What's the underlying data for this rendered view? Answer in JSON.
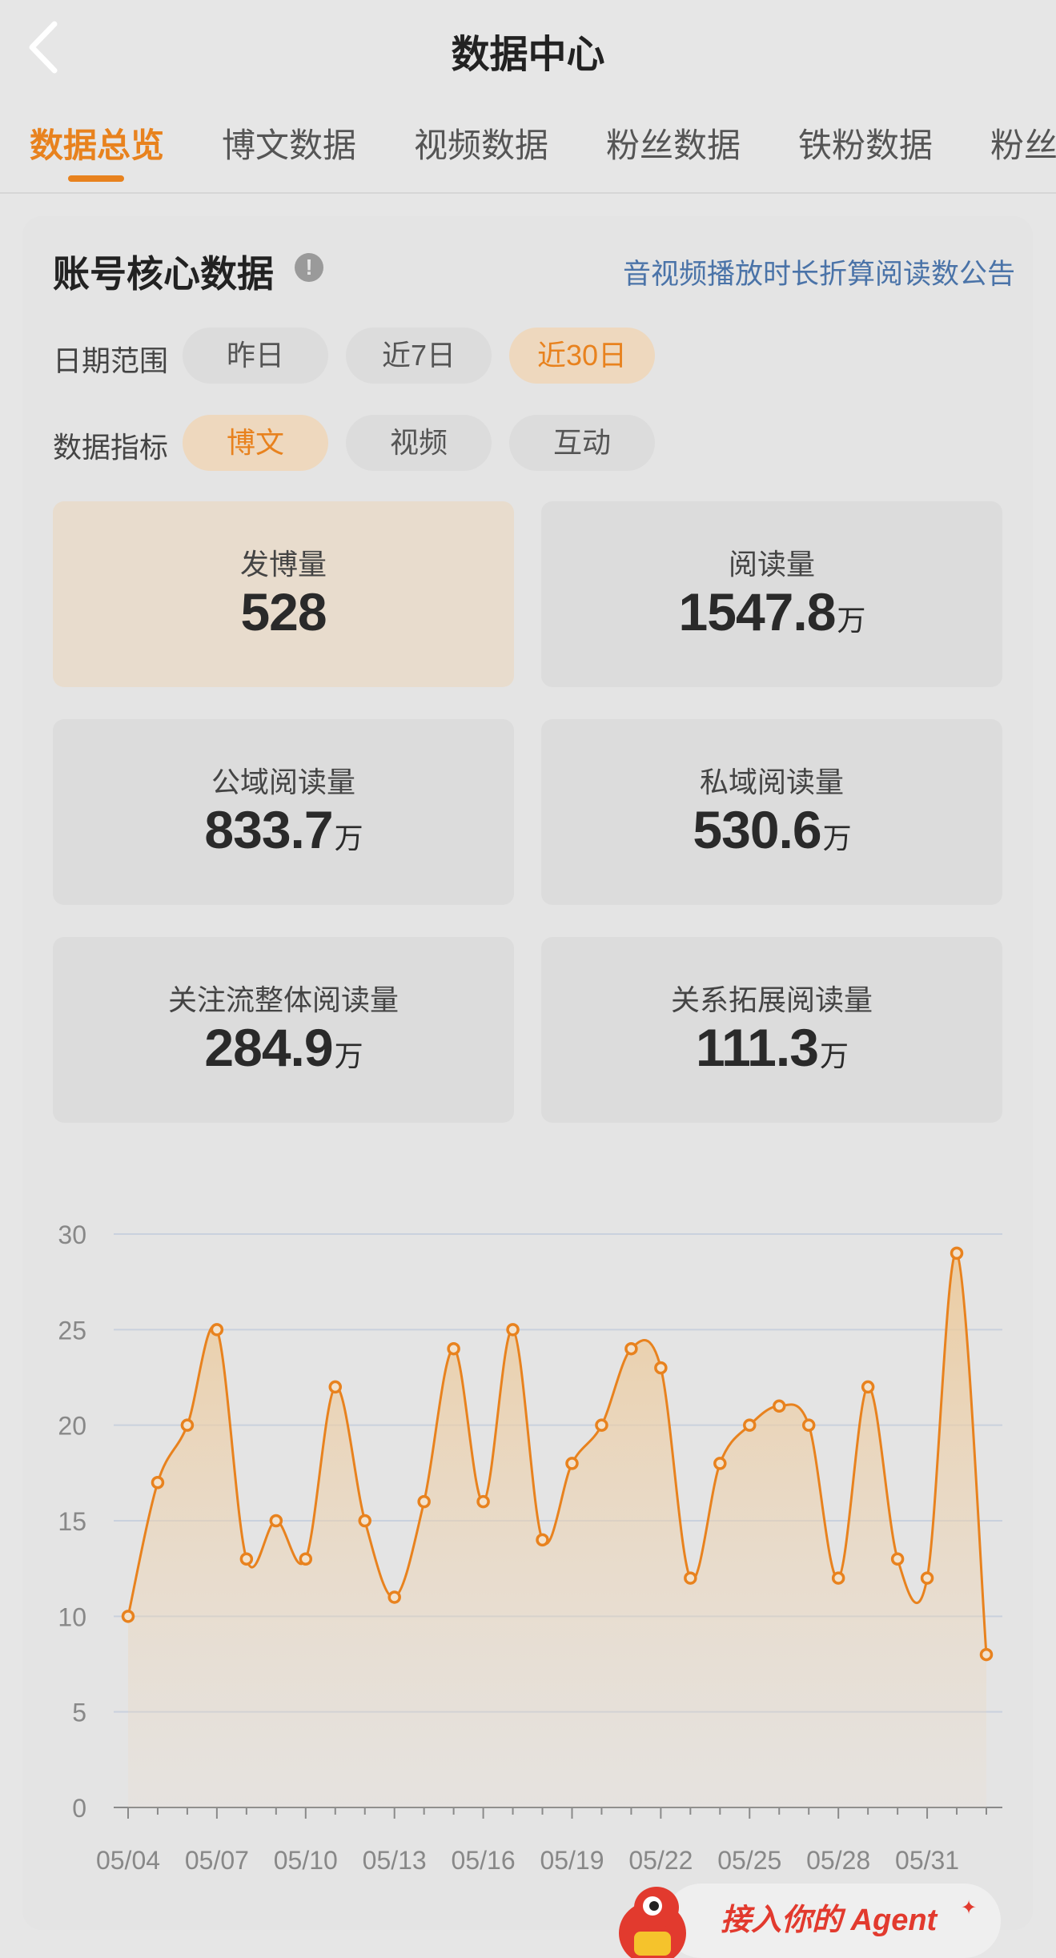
{
  "header": {
    "title": "数据中心"
  },
  "tabs": [
    {
      "label": "数据总览",
      "active": true
    },
    {
      "label": "博文数据"
    },
    {
      "label": "视频数据"
    },
    {
      "label": "粉丝数据"
    },
    {
      "label": "铁粉数据"
    },
    {
      "label": "粉丝"
    }
  ],
  "core": {
    "title": "账号核心数据",
    "info_icon": "!",
    "notice_link": "音视频播放时长折算阅读数公告",
    "date_range": {
      "label": "日期范围",
      "options": [
        "昨日",
        "近7日",
        "近30日"
      ],
      "selected": "近30日"
    },
    "metric": {
      "label": "数据指标",
      "options": [
        "博文",
        "视频",
        "互动"
      ],
      "selected": "博文"
    }
  },
  "stats": [
    {
      "label": "发博量",
      "value": "528",
      "unit": "",
      "active": true
    },
    {
      "label": "阅读量",
      "value": "1547.8",
      "unit": "万"
    },
    {
      "label": "公域阅读量",
      "value": "833.7",
      "unit": "万"
    },
    {
      "label": "私域阅读量",
      "value": "530.6",
      "unit": "万"
    },
    {
      "label": "关注流整体阅读量",
      "value": "284.9",
      "unit": "万"
    },
    {
      "label": "关系拓展阅读量",
      "value": "111.3",
      "unit": "万"
    }
  ],
  "chart_data": {
    "type": "area",
    "x": [
      "05/04",
      "05/05",
      "05/06",
      "05/07",
      "05/08",
      "05/09",
      "05/10",
      "05/11",
      "05/12",
      "05/13",
      "05/14",
      "05/15",
      "05/16",
      "05/17",
      "05/18",
      "05/19",
      "05/20",
      "05/21",
      "05/22",
      "05/23",
      "05/24",
      "05/25",
      "05/26",
      "05/27",
      "05/28",
      "05/29",
      "05/30",
      "05/31",
      "06/01",
      "06/02"
    ],
    "tick_labels": [
      "05/04",
      "05/07",
      "05/10",
      "05/13",
      "05/16",
      "05/19",
      "05/22",
      "05/25",
      "05/28",
      "05/31"
    ],
    "values": [
      10,
      17,
      20,
      25,
      13,
      15,
      13,
      22,
      15,
      11,
      16,
      24,
      16,
      25,
      14,
      18,
      20,
      24,
      23,
      12,
      18,
      20,
      21,
      20,
      12,
      22,
      13,
      12,
      29,
      8
    ],
    "yticks": [
      0,
      5,
      10,
      15,
      20,
      25,
      30
    ],
    "ylim": [
      0,
      30
    ],
    "grid": true,
    "color": "#e8821e"
  },
  "banner": {
    "text": "接入你的 Agent"
  }
}
